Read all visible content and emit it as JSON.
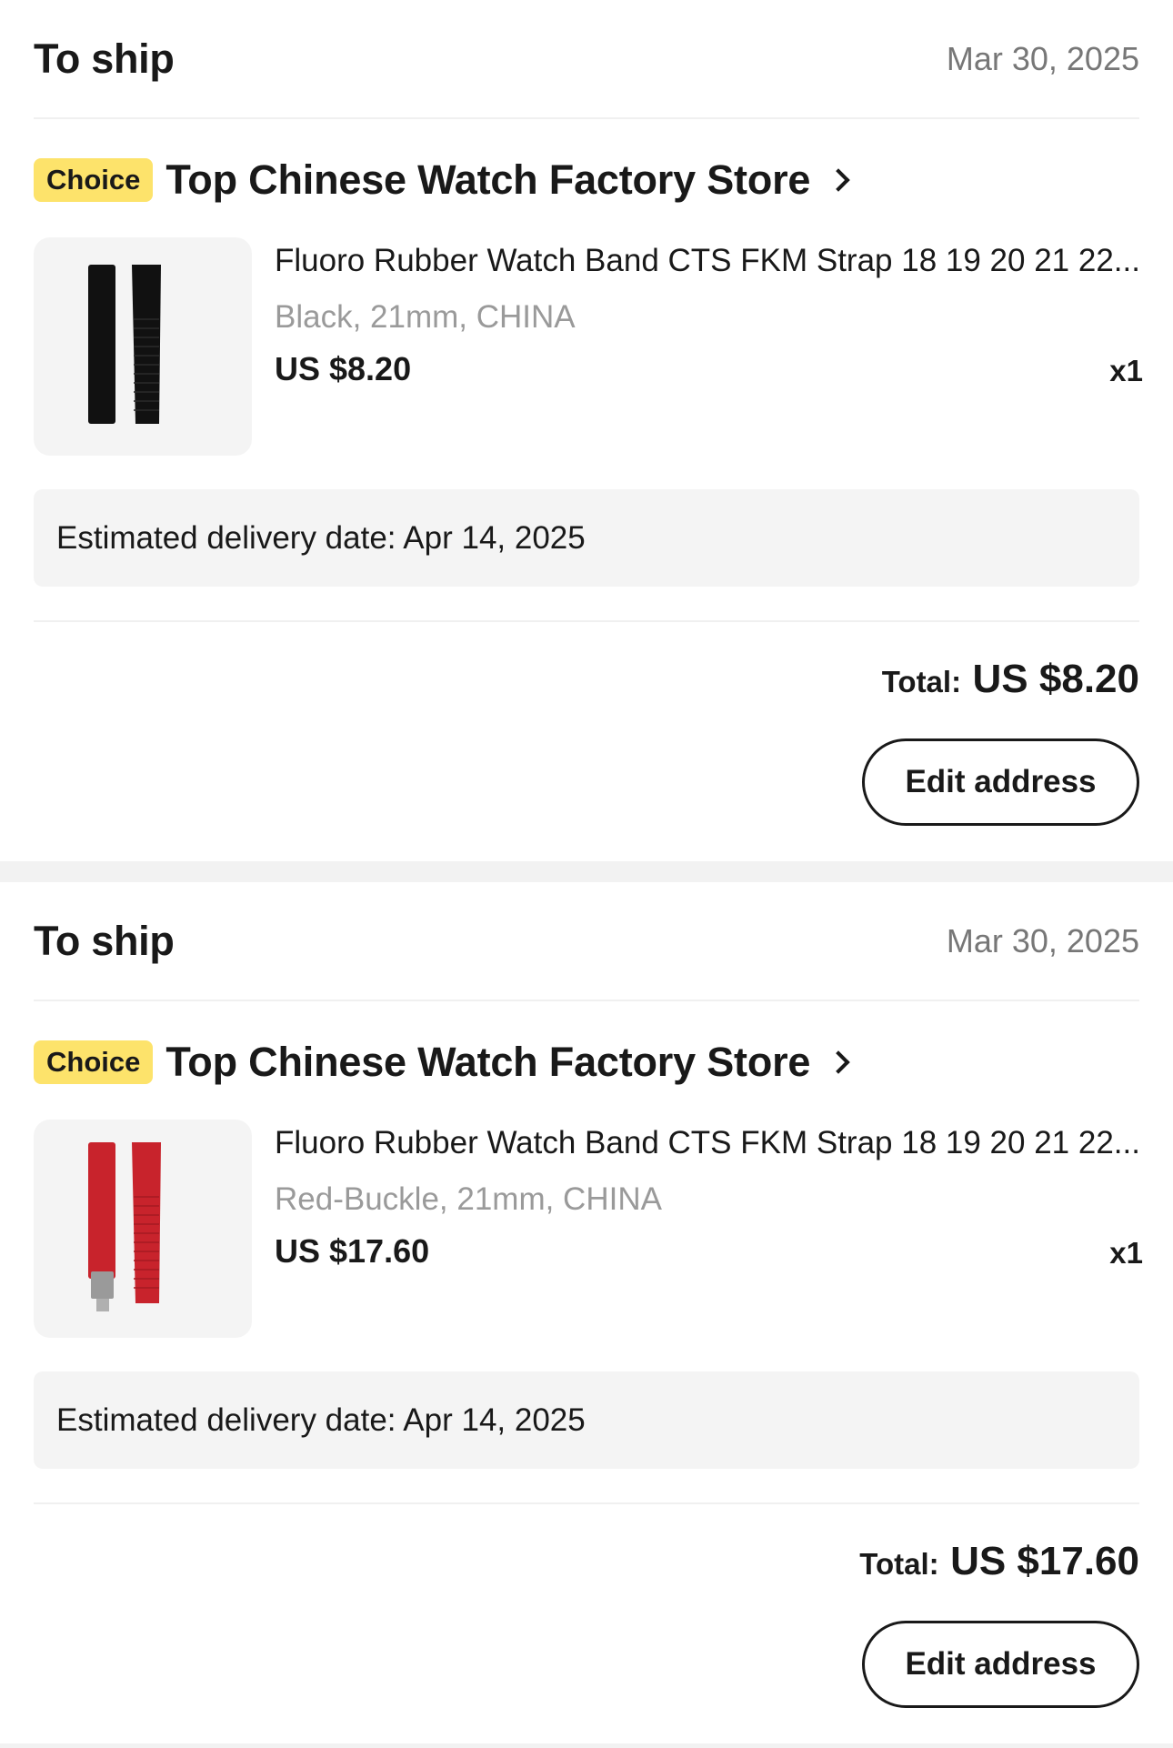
{
  "orders": [
    {
      "status": "To ship",
      "date": "Mar 30, 2025",
      "badge": "Choice",
      "store": "Top Chinese Watch Factory Store",
      "product": {
        "title": "Fluoro Rubber Watch Band CTS FKM Strap 18 19 20 21 22...",
        "variant": "Black, 21mm, CHINA",
        "price": "US $8.20",
        "quantity": "x1",
        "image_color": "#111111"
      },
      "delivery": "Estimated delivery date: Apr 14, 2025",
      "total_label": "Total:",
      "total_value": "US $8.20",
      "action_label": "Edit address"
    },
    {
      "status": "To ship",
      "date": "Mar 30, 2025",
      "badge": "Choice",
      "store": "Top Chinese Watch Factory Store",
      "product": {
        "title": "Fluoro Rubber Watch Band CTS FKM Strap 18 19 20 21 22...",
        "variant": "Red-Buckle, 21mm, CHINA",
        "price": "US $17.60",
        "quantity": "x1",
        "image_color": "#c8232c"
      },
      "delivery": "Estimated delivery date: Apr 14, 2025",
      "total_label": "Total:",
      "total_value": "US $17.60",
      "action_label": "Edit address"
    }
  ],
  "colors": {
    "badge_bg": "#fde36b",
    "text": "#191919",
    "muted": "#777777",
    "panel_bg": "#f4f4f4"
  }
}
